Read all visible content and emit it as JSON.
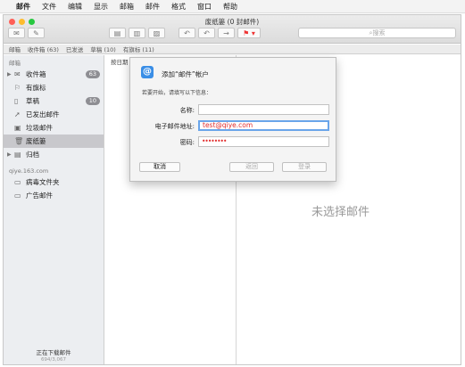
{
  "menubar": {
    "items": [
      "邮件",
      "文件",
      "编辑",
      "显示",
      "邮箱",
      "邮件",
      "格式",
      "窗口",
      "帮助"
    ]
  },
  "window": {
    "title": "废纸篓 (0 封邮件)"
  },
  "search": {
    "placeholder": "搜索"
  },
  "favbar": {
    "mailboxes": "邮箱",
    "inbox": "收件箱 (63)",
    "sent": "已发送",
    "drafts": "草稿 (10)",
    "flagged": "有旗标 (11)"
  },
  "sidebar": {
    "section1": "邮箱",
    "items": [
      {
        "label": "收件箱",
        "badge": "63",
        "icon": "inbox-icon"
      },
      {
        "label": "有旗标",
        "icon": "flag-icon"
      },
      {
        "label": "草稿",
        "badge": "10",
        "icon": "draft-icon"
      },
      {
        "label": "已发出邮件",
        "icon": "sent-icon"
      },
      {
        "label": "垃圾邮件",
        "icon": "junk-icon"
      },
      {
        "label": "废纸篓",
        "icon": "trash-icon"
      },
      {
        "label": "归档",
        "icon": "archive-icon"
      }
    ],
    "section2": "qiye.163.com",
    "items2": [
      {
        "label": "病毒文件夹",
        "icon": "folder-icon"
      },
      {
        "label": "广告邮件",
        "icon": "folder-icon"
      }
    ],
    "status": "正在下载邮件",
    "status_sub": "694/3,067"
  },
  "msglist": {
    "sort": "按日期"
  },
  "viewer": {
    "empty": "未选择邮件"
  },
  "dialog": {
    "title": "添加“邮件”帐户",
    "subtitle": "若要开始，请填写以下信息：",
    "name_label": "名称:",
    "name_value": "",
    "email_label": "电子邮件地址:",
    "email_value": "test@qiye.com",
    "password_label": "密码:",
    "password_value": "••••••••",
    "cancel": "取消",
    "back": "返回",
    "login": "登录"
  },
  "colors": {
    "accent": "#3a8ee6",
    "red": "#ff5f57",
    "yellow": "#febc2e",
    "green": "#28c840"
  }
}
